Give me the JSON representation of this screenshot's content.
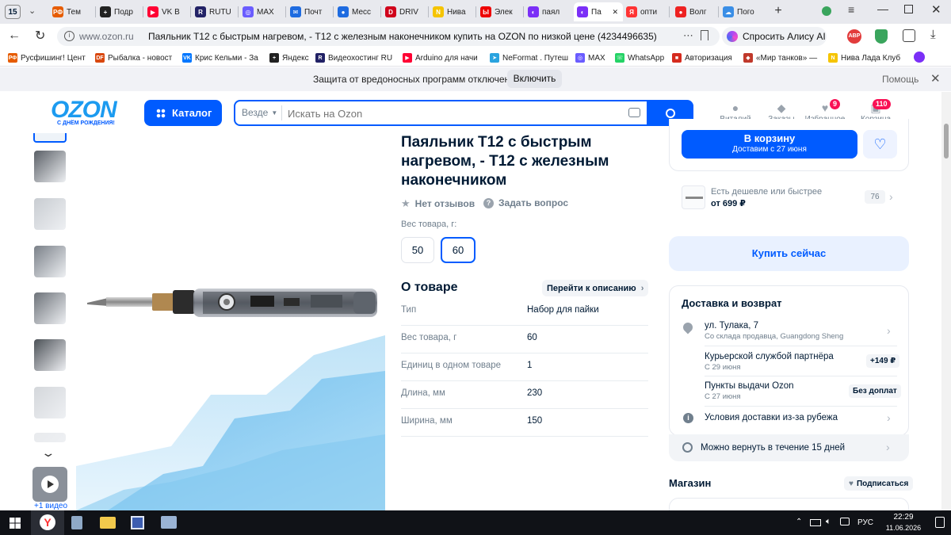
{
  "browser": {
    "tab_counter": "15",
    "tabs": [
      {
        "label": "Тем",
        "color": "#e65c00",
        "glyph": "РФ"
      },
      {
        "label": "Подр",
        "color": "#222",
        "glyph": "+"
      },
      {
        "label": "VK В",
        "color": "#ff0033",
        "glyph": "▶"
      },
      {
        "label": "RUTU",
        "color": "#222266",
        "glyph": "R"
      },
      {
        "label": "MAX",
        "color": "#6a5cff",
        "glyph": "◎"
      },
      {
        "label": "Почт",
        "color": "#1e6be0",
        "glyph": "✉"
      },
      {
        "label": "Месс",
        "color": "#1e6be0",
        "glyph": "●"
      },
      {
        "label": "DRIV",
        "color": "#d0021b",
        "glyph": "D"
      },
      {
        "label": "Нива",
        "color": "#f5c400",
        "glyph": "N"
      },
      {
        "label": "Элек",
        "color": "#e00",
        "glyph": "Ы"
      },
      {
        "label": "паял",
        "color": "#7b2ff7",
        "glyph": "◐"
      },
      {
        "label": "Па",
        "color": "#7b2ff7",
        "glyph": "◐",
        "active": true
      },
      {
        "label": "опти",
        "color": "#f33",
        "glyph": "Я"
      },
      {
        "label": "Волг",
        "color": "#e22",
        "glyph": "●"
      },
      {
        "label": "Пого",
        "color": "#3a8ee6",
        "glyph": "☁"
      }
    ],
    "url_host": "www.ozon.ru",
    "page_title": "Паяльник Т12 с быстрым нагревом, - Т12 с железным наконечником купить на OZON по низкой цене (4234496635)",
    "alice_label": "Спросить Алису AI",
    "bookmarks": [
      {
        "label": "Русфишинг! Цент",
        "color": "#e65c00",
        "glyph": "РФ"
      },
      {
        "label": "Рыбалка - новост",
        "color": "#d9480f",
        "glyph": "DF"
      },
      {
        "label": "Крис Кельми - За",
        "color": "#0077ff",
        "glyph": "VK"
      },
      {
        "label": "Яндекс",
        "color": "#222",
        "glyph": "+"
      },
      {
        "label": "Видеохостинг RU",
        "color": "#222266",
        "glyph": "R"
      },
      {
        "label": "Arduino для начи",
        "color": "#ff0033",
        "glyph": "▶"
      },
      {
        "label": "NeFormat . Путеш",
        "color": "#2aa3df",
        "glyph": "➤"
      },
      {
        "label": "MAX",
        "color": "#6a5cff",
        "glyph": "◎"
      },
      {
        "label": "WhatsApp",
        "color": "#25d366",
        "glyph": "☏"
      },
      {
        "label": "Авторизация",
        "color": "#d52b1e",
        "glyph": "■"
      },
      {
        "label": "«Мир танков» — ",
        "color": "#c0392b",
        "glyph": "◆"
      },
      {
        "label": "Нива Лада Клуб ",
        "color": "#f5c400",
        "glyph": "N"
      }
    ],
    "infobar_text": "Защита от вредоносных программ отключена",
    "infobar_button": "Включить",
    "infobar_help": "Помощь"
  },
  "header": {
    "logo": "OZON",
    "logo_sub": "С ДНЁМ РОЖДЕНИЯ!",
    "catalog_label": "Каталог",
    "search_scope": "Везде",
    "search_placeholder": "Искать на Ozon",
    "nav": [
      {
        "label": "Виталий",
        "badge": ""
      },
      {
        "label": "Заказы",
        "badge": ""
      },
      {
        "label": "Избранное",
        "badge": "9"
      },
      {
        "label": "Корзина",
        "badge": "110"
      }
    ]
  },
  "gallery": {
    "video_label": "+1 видео"
  },
  "product": {
    "title_lines": [
      "Паяльник Т12 с быстрым",
      "нагревом, - Т12 с железным",
      "наконечником"
    ],
    "reviews": "Нет отзывов",
    "question": "Задать вопрос",
    "variant_label": "Вес товара, г:",
    "variants": [
      "50",
      "60"
    ],
    "about_title": "О товаре",
    "about_link": "Перейти к описанию",
    "specs": [
      {
        "k": "Тип",
        "v": "Набор для пайки"
      },
      {
        "k": "Вес товара, г",
        "v": "60"
      },
      {
        "k": "Единиц в одном товаре",
        "v": "1"
      },
      {
        "k": "Длина, мм",
        "v": "230"
      },
      {
        "k": "Ширина, мм",
        "v": "150"
      }
    ]
  },
  "buy": {
    "cart_label": "В корзину",
    "cart_sub": "Доставим с 27 июня",
    "cheaper_label": "Есть дешевле или быстрее",
    "cheaper_price": "от 699 ₽",
    "cheaper_count": "76",
    "buy_now": "Купить сейчас"
  },
  "delivery": {
    "title": "Доставка и возврат",
    "address": "ул. Тулака, 7",
    "address_sub": "Со склада продавца, Guangdong Sheng",
    "courier": "Курьерской службой партнёра",
    "courier_sub": "С 29 июня",
    "courier_price": "+149 ₽",
    "pickup": "Пункты выдачи Ozon",
    "pickup_sub": "С 27 июня",
    "pickup_price": "Без доплат",
    "abroad": "Условия доставки из-за рубежа",
    "return": "Можно вернуть в течение 15 дней"
  },
  "shop": {
    "title": "Магазин",
    "subscribe": "Подписаться"
  },
  "taskbar": {
    "lang": "РУС",
    "time": "22:29",
    "date": "11.06.2026"
  }
}
